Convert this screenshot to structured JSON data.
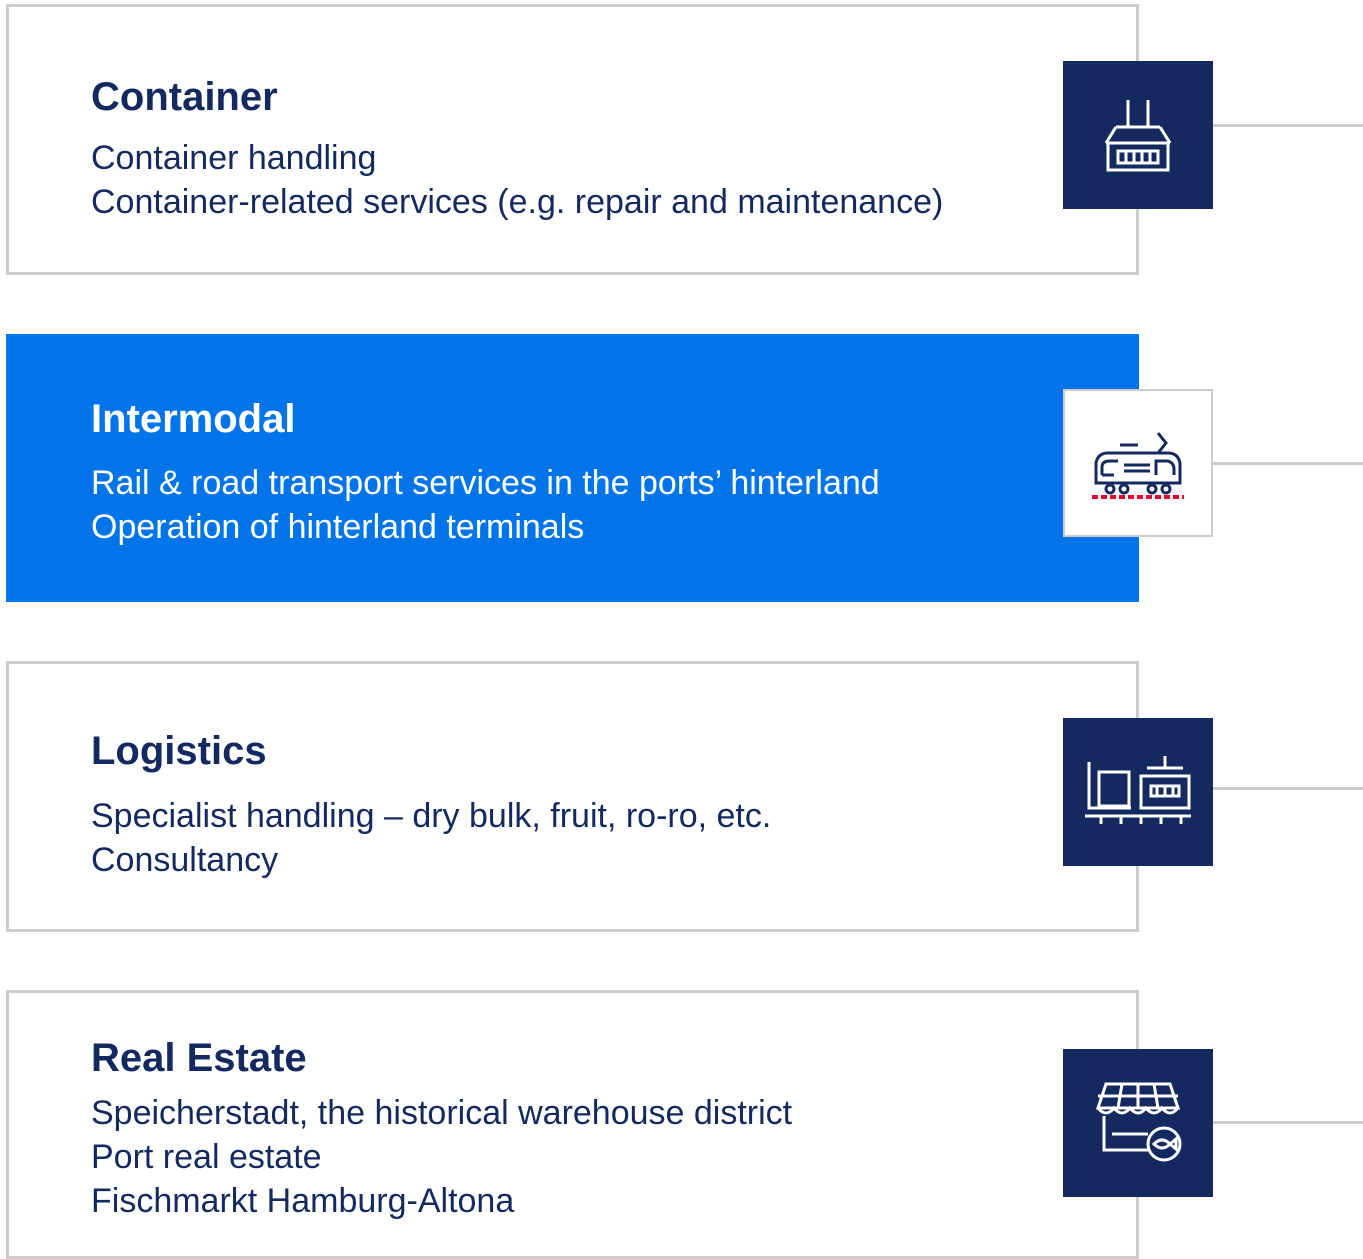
{
  "segments": [
    {
      "title": "Container",
      "lines": [
        "Container handling",
        "Container-related services (e.g. repair and maintenance)"
      ],
      "icon": "container-crane-icon"
    },
    {
      "title": "Intermodal",
      "lines": [
        "Rail & road transport services in the ports’ hinterland",
        "Operation of hinterland terminals"
      ],
      "icon": "train-icon"
    },
    {
      "title": "Logistics",
      "lines": [
        "Specialist handling – dry bulk, fruit, ro-ro, etc.",
        "Consultancy"
      ],
      "icon": "logistics-warehouse-icon"
    },
    {
      "title": "Real Estate",
      "lines": [
        "Speicherstadt, the historical warehouse district",
        "Port real estate",
        "Fischmarkt Hamburg-Altona"
      ],
      "icon": "fish-market-stall-icon"
    }
  ],
  "colors": {
    "navy": "#13295f",
    "highlight_blue": "#0074e8",
    "border_gray": "#cccccc",
    "rail_red": "#e4032e"
  }
}
